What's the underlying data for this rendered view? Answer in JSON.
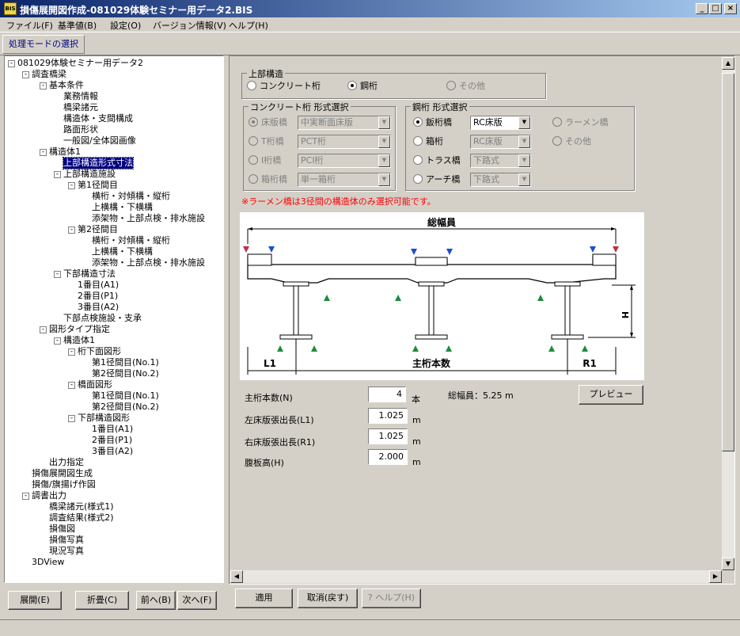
{
  "window": {
    "title": "損傷展開図作成-081029体験セミナー用データ2.BIS",
    "icon_text": "BIS",
    "min_label": "_",
    "max_label": "□",
    "close_label": "×"
  },
  "menu": [
    "ファイル(F)",
    "基準値(B)",
    "設定(O)",
    "バージョン情報(V)",
    "ヘルプ(H)"
  ],
  "toolbar": {
    "mode_button": "処理モードの選択"
  },
  "tree": [
    {
      "label": "081029体験セミナー用データ2",
      "level": 0,
      "box": "-"
    },
    {
      "label": "調査橋梁",
      "level": 1,
      "box": "-"
    },
    {
      "label": "基本条件",
      "level": 2,
      "box": "-"
    },
    {
      "label": "業務情報",
      "level": 3
    },
    {
      "label": "橋梁諸元",
      "level": 3
    },
    {
      "label": "構造体・支間構成",
      "level": 3
    },
    {
      "label": "路面形状",
      "level": 3
    },
    {
      "label": "一般図/全体図画像",
      "level": 3
    },
    {
      "label": "構造体1",
      "level": 2,
      "box": "-"
    },
    {
      "label": "上部構造形式寸法",
      "level": 3,
      "selected": true
    },
    {
      "label": "上部構造施設",
      "level": 3,
      "box": "-"
    },
    {
      "label": "第1径間目",
      "level": 4,
      "box": "-"
    },
    {
      "label": "横桁・対傾構・縦桁",
      "level": 5
    },
    {
      "label": "上横構・下横構",
      "level": 5
    },
    {
      "label": "添架物・上部点検・排水施設",
      "level": 5
    },
    {
      "label": "第2径間目",
      "level": 4,
      "box": "-"
    },
    {
      "label": "横桁・対傾構・縦桁",
      "level": 5
    },
    {
      "label": "上横構・下横構",
      "level": 5
    },
    {
      "label": "添架物・上部点検・排水施設",
      "level": 5
    },
    {
      "label": "下部構造寸法",
      "level": 3,
      "box": "-"
    },
    {
      "label": "1番目(A1)",
      "level": 4
    },
    {
      "label": "2番目(P1)",
      "level": 4
    },
    {
      "label": "3番目(A2)",
      "level": 4
    },
    {
      "label": "下部点検施設・支承",
      "level": 3
    },
    {
      "label": "図形タイプ指定",
      "level": 2,
      "box": "-"
    },
    {
      "label": "構造体1",
      "level": 3,
      "box": "-"
    },
    {
      "label": "桁下面図形",
      "level": 4,
      "box": "-"
    },
    {
      "label": "第1径間目(No.1)",
      "level": 5
    },
    {
      "label": "第2径間目(No.2)",
      "level": 5
    },
    {
      "label": "橋面図形",
      "level": 4,
      "box": "-"
    },
    {
      "label": "第1径間目(No.1)",
      "level": 5
    },
    {
      "label": "第2径間目(No.2)",
      "level": 5
    },
    {
      "label": "下部構造図形",
      "level": 4,
      "box": "-"
    },
    {
      "label": "1番目(A1)",
      "level": 5
    },
    {
      "label": "2番目(P1)",
      "level": 5
    },
    {
      "label": "3番目(A2)",
      "level": 5
    },
    {
      "label": "出力指定",
      "level": 2
    },
    {
      "label": "損傷展開図生成",
      "level": 1
    },
    {
      "label": "損傷/旗揚げ作図",
      "level": 1
    },
    {
      "label": "調書出力",
      "level": 1,
      "box": "-"
    },
    {
      "label": "橋梁諸元(様式1)",
      "level": 2
    },
    {
      "label": "調査結果(様式2)",
      "level": 2
    },
    {
      "label": "損傷図",
      "level": 2
    },
    {
      "label": "損傷写真",
      "level": 2
    },
    {
      "label": "現況写真",
      "level": 2
    },
    {
      "label": "3DView",
      "level": 1
    }
  ],
  "left_buttons": {
    "expand": "展開(E)",
    "collapse": "折畳(C)",
    "prev": "前へ(B)",
    "next": "次へ(F)"
  },
  "superstructure": {
    "title": "上部構造",
    "concrete": "コンクリート桁",
    "steel": "鋼桁",
    "other": "その他"
  },
  "concrete_form": {
    "title": "コンクリート桁 形式選択",
    "rows": [
      {
        "label": "床版橋",
        "value": "中実断面床版"
      },
      {
        "label": "T桁橋",
        "value": "PCT桁"
      },
      {
        "label": "I桁橋",
        "value": "PCI桁"
      },
      {
        "label": "箱桁橋",
        "value": "単一箱桁"
      }
    ]
  },
  "steel_form": {
    "title": "鋼桁 形式選択",
    "rows": [
      {
        "label": "鈑桁橋",
        "value": "RC床版"
      },
      {
        "label": "箱桁",
        "value": "RC床版"
      },
      {
        "label": "トラス橋",
        "value": "下路式"
      },
      {
        "label": "アーチ橋",
        "value": "下路式"
      }
    ],
    "rahmen": "ラーメン橋",
    "other": "その他"
  },
  "warning": "※ラーメン橋は3径間の構造体のみ選択可能です。",
  "diagram": {
    "total_width": "総幅員",
    "main_girders": "主桁本数",
    "l1": "L1",
    "r1": "R1",
    "h": "H"
  },
  "fields": {
    "girder_count_label": "主桁本数(N)",
    "girder_count": "4",
    "girder_unit": "本",
    "left_overhang_label": "左床版張出長(L1)",
    "left_overhang": "1.025",
    "left_unit": "m",
    "right_overhang_label": "右床版張出長(R1)",
    "right_overhang": "1.025",
    "right_unit": "m",
    "web_height_label": "腹板高(H)",
    "web_height": "2.000",
    "web_unit": "m",
    "total_width_text": "総幅員：5.25 m",
    "preview": "プレビュー"
  },
  "bottom_buttons": {
    "apply": "適用",
    "cancel": "取消(戻す)",
    "help": "ヘルプ(H)"
  },
  "colors": {
    "warning": "#ff0000",
    "title_start": "#0a246a",
    "title_end": "#a6caf0"
  }
}
